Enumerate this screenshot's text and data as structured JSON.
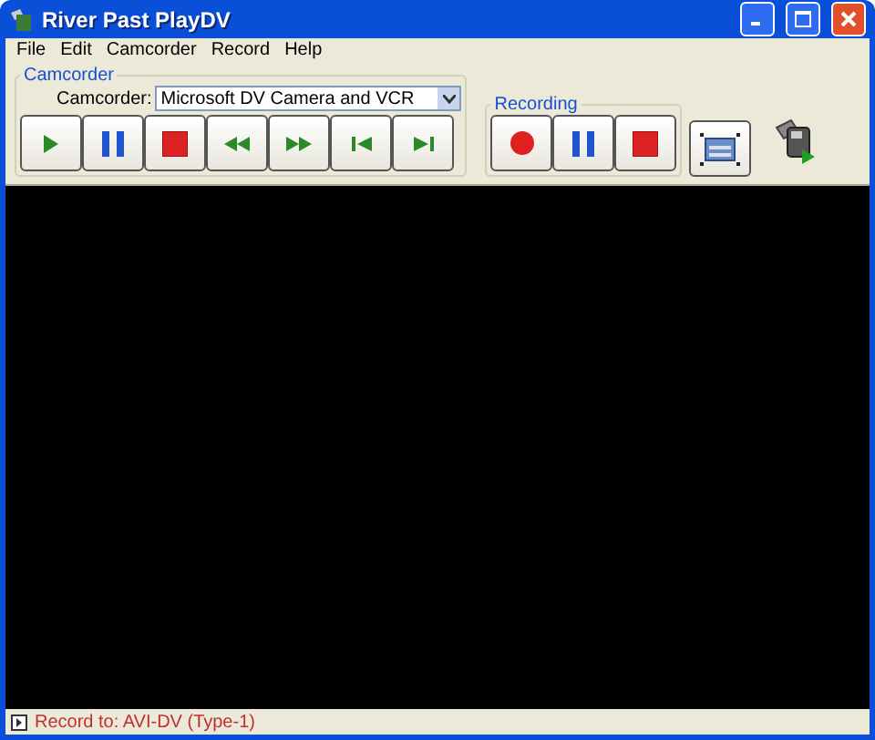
{
  "window": {
    "title": "River Past PlayDV"
  },
  "menu": [
    "File",
    "Edit",
    "Camcorder",
    "Record",
    "Help"
  ],
  "camcorder": {
    "group_label": "Camcorder",
    "label": "Camcorder:",
    "dropdown_value": "Microsoft DV Camera and VCR",
    "buttons": [
      {
        "kind": "play"
      },
      {
        "kind": "pause"
      },
      {
        "kind": "stop"
      },
      {
        "kind": "rewind"
      },
      {
        "kind": "forward"
      },
      {
        "kind": "prev"
      },
      {
        "kind": "next"
      }
    ]
  },
  "recording": {
    "group_label": "Recording",
    "buttons": [
      {
        "kind": "record"
      },
      {
        "kind": "pause"
      },
      {
        "kind": "stop"
      }
    ]
  },
  "tools": [
    {
      "kind": "fullscreen"
    },
    {
      "kind": "camera"
    }
  ],
  "status_bar": {
    "text": "Record to: AVI-DV (Type-1)"
  }
}
